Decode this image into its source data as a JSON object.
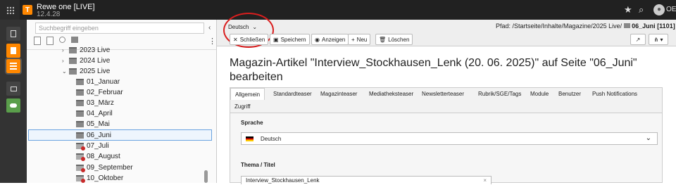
{
  "topbar": {
    "site_name": "Rewe one [LIVE]",
    "version": "12.4.28",
    "logo_letter": "T",
    "user": "OED",
    "bookmark_icon": "star-icon",
    "search_icon": "search-icon"
  },
  "tree": {
    "search_placeholder": "Suchbegriff eingeben",
    "collapse": "‹",
    "more": "⋮",
    "nodes": [
      {
        "label": "2023 Live",
        "arrow": "›"
      },
      {
        "label": "2024 Live",
        "arrow": "›"
      },
      {
        "label": "2025 Live",
        "arrow": "⌄"
      },
      {
        "label": "01_Januar"
      },
      {
        "label": "02_Februar"
      },
      {
        "label": "03_März"
      },
      {
        "label": "04_April"
      },
      {
        "label": "05_Mai"
      },
      {
        "label": "06_Juni"
      },
      {
        "label": "07_Juli"
      },
      {
        "label": "08_August"
      },
      {
        "label": "09_September"
      },
      {
        "label": "10_Oktober"
      }
    ]
  },
  "docheader": {
    "language": "Deutsch",
    "path_label": "Pfad: /Startseite/Inhalte/Magazine/2025 Live/",
    "path_current": "06_Juni [1101]",
    "buttons": {
      "close": "Schließen",
      "save": "Speichern",
      "view": "Anzeigen",
      "new": "Neu",
      "delete": "Löschen"
    }
  },
  "main": {
    "title": "Magazin-Artikel \"Interview_Stockhausen_Lenk (20. 06. 2025)\" auf Seite \"06_Juni\" bearbeiten",
    "tabs": [
      "Allgemein",
      "Standardteaser",
      "Magazinteaser",
      "Mediatheksteaser",
      "Newsletterteaser",
      "Rubrik/SGE/Tags",
      "Module",
      "Benutzer",
      "Push Notifications",
      "Zugriff"
    ],
    "language_label": "Sprache",
    "language_value": "Deutsch",
    "topic_label": "Thema / Titel",
    "topic_value": "Interview_Stockhausen_Lenk"
  },
  "colors": {
    "topbar": "#212121",
    "modulebar": "#333333",
    "accent": "#ff8700",
    "highlight": "#d91e1e"
  }
}
